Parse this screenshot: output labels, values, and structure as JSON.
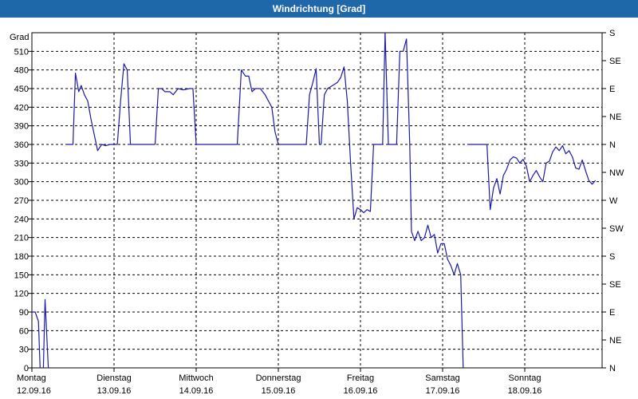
{
  "window": {
    "title": "Windrichtung [Grad]"
  },
  "colors": {
    "titlebar": "#1e67a8",
    "line": "#1a1aa6",
    "grid": "#000000"
  },
  "chart_data": {
    "type": "line",
    "title": "Windrichtung [Grad]",
    "ylabel": "Grad",
    "ylim": [
      0,
      540
    ],
    "yticks": [
      0,
      30,
      60,
      90,
      120,
      150,
      180,
      210,
      240,
      270,
      300,
      330,
      360,
      390,
      420,
      450,
      480,
      510
    ],
    "right_axis": {
      "labels": [
        "N",
        "NE",
        "E",
        "SE",
        "S",
        "SW",
        "W",
        "NW",
        "N",
        "NE",
        "E",
        "SE",
        "S"
      ],
      "values": [
        0,
        45,
        90,
        135,
        180,
        225,
        270,
        315,
        360,
        405,
        450,
        495,
        540
      ]
    },
    "x_unit": "days",
    "xlim": [
      0,
      7
    ],
    "day_ticks": [
      {
        "day": "Montag",
        "date": "12.09.16"
      },
      {
        "day": "Dienstag",
        "date": "13.09.16"
      },
      {
        "day": "Mittwoch",
        "date": "14.09.16"
      },
      {
        "day": "Donnerstag",
        "date": "15.09.16"
      },
      {
        "day": "Freitag",
        "date": "16.09.16"
      },
      {
        "day": "Samstag",
        "date": "17.09.16"
      },
      {
        "day": "Sonntag",
        "date": "18.09.16"
      }
    ],
    "grid": true,
    "series": [
      {
        "name": "",
        "segments": [
          [
            [
              0.0,
              90
            ],
            [
              0.04,
              90
            ],
            [
              0.08,
              75
            ],
            [
              0.1,
              0
            ]
          ],
          [
            [
              0.14,
              0
            ],
            [
              0.16,
              110
            ],
            [
              0.2,
              0
            ]
          ],
          [
            [
              0.42,
              360
            ],
            [
              0.5,
              360
            ],
            [
              0.53,
              475
            ],
            [
              0.57,
              445
            ],
            [
              0.6,
              455
            ],
            [
              0.64,
              440
            ],
            [
              0.68,
              430
            ],
            [
              0.72,
              400
            ],
            [
              0.76,
              375
            ],
            [
              0.8,
              350
            ],
            [
              0.85,
              360
            ],
            [
              0.9,
              358
            ],
            [
              0.95,
              360
            ],
            [
              1.0,
              360
            ],
            [
              1.04,
              360
            ],
            [
              1.08,
              430
            ],
            [
              1.12,
              490
            ],
            [
              1.16,
              480
            ],
            [
              1.2,
              360
            ],
            [
              1.3,
              360
            ],
            [
              1.5,
              360
            ]
          ],
          [
            [
              1.5,
              360
            ],
            [
              1.54,
              450
            ],
            [
              1.58,
              450
            ],
            [
              1.62,
              445
            ],
            [
              1.68,
              445
            ],
            [
              1.72,
              440
            ],
            [
              1.78,
              450
            ],
            [
              1.84,
              448
            ],
            [
              1.92,
              450
            ],
            [
              1.96,
              450
            ],
            [
              2.0,
              360
            ],
            [
              2.1,
              360
            ],
            [
              2.5,
              360
            ]
          ],
          [
            [
              2.5,
              360
            ],
            [
              2.55,
              480
            ],
            [
              2.6,
              470
            ],
            [
              2.64,
              470
            ],
            [
              2.68,
              445
            ],
            [
              2.72,
              450
            ],
            [
              2.78,
              450
            ],
            [
              2.84,
              440
            ],
            [
              2.88,
              430
            ],
            [
              2.92,
              420
            ],
            [
              2.96,
              380
            ],
            [
              3.0,
              360
            ],
            [
              3.1,
              360
            ],
            [
              3.3,
              360
            ]
          ],
          [
            [
              3.3,
              360
            ],
            [
              3.34,
              360
            ],
            [
              3.38,
              440
            ],
            [
              3.42,
              460
            ],
            [
              3.46,
              482
            ],
            [
              3.5,
              360
            ],
            [
              3.52,
              360
            ],
            [
              3.56,
              440
            ],
            [
              3.6,
              450
            ],
            [
              3.66,
              455
            ],
            [
              3.72,
              460
            ],
            [
              3.76,
              468
            ],
            [
              3.8,
              485
            ],
            [
              3.84,
              430
            ],
            [
              3.88,
              330
            ],
            [
              3.92,
              240
            ],
            [
              3.96,
              258
            ],
            [
              4.0,
              255
            ],
            [
              4.04,
              250
            ],
            [
              4.08,
              255
            ],
            [
              4.12,
              252
            ],
            [
              4.16,
              360
            ],
            [
              4.2,
              360
            ],
            [
              4.27,
              360
            ],
            [
              4.3,
              545
            ]
          ],
          [
            [
              4.3,
              545
            ],
            [
              4.34,
              360
            ],
            [
              4.4,
              360
            ],
            [
              4.44,
              360
            ],
            [
              4.48,
              510
            ],
            [
              4.52,
              510
            ],
            [
              4.56,
              530
            ],
            [
              4.6,
              360
            ],
            [
              4.62,
              220
            ],
            [
              4.66,
              205
            ],
            [
              4.7,
              220
            ],
            [
              4.74,
              205
            ],
            [
              4.78,
              210
            ],
            [
              4.82,
              230
            ],
            [
              4.86,
              210
            ],
            [
              4.9,
              215
            ],
            [
              4.94,
              185
            ],
            [
              4.98,
              200
            ],
            [
              5.02,
              200
            ],
            [
              5.06,
              175
            ],
            [
              5.1,
              165
            ],
            [
              5.14,
              150
            ],
            [
              5.18,
              168
            ],
            [
              5.22,
              150
            ],
            [
              5.25,
              0
            ]
          ],
          [
            [
              5.3,
              360
            ],
            [
              5.5,
              360
            ],
            [
              5.54,
              360
            ],
            [
              5.58,
              255
            ],
            [
              5.62,
              290
            ],
            [
              5.66,
              305
            ],
            [
              5.7,
              280
            ],
            [
              5.74,
              310
            ],
            [
              5.78,
              320
            ],
            [
              5.82,
              335
            ],
            [
              5.86,
              340
            ],
            [
              5.9,
              338
            ],
            [
              5.94,
              330
            ],
            [
              5.98,
              336
            ],
            [
              6.02,
              325
            ],
            [
              6.06,
              300
            ],
            [
              6.1,
              310
            ],
            [
              6.14,
              318
            ],
            [
              6.18,
              308
            ],
            [
              6.22,
              300
            ],
            [
              6.26,
              330
            ],
            [
              6.3,
              333
            ],
            [
              6.34,
              348
            ],
            [
              6.38,
              356
            ],
            [
              6.42,
              350
            ],
            [
              6.46,
              358
            ],
            [
              6.5,
              345
            ],
            [
              6.54,
              350
            ],
            [
              6.58,
              340
            ],
            [
              6.62,
              322
            ],
            [
              6.66,
              320
            ],
            [
              6.7,
              335
            ],
            [
              6.74,
              318
            ],
            [
              6.78,
              302
            ],
            [
              6.82,
              296
            ],
            [
              6.86,
              302
            ]
          ]
        ]
      }
    ]
  }
}
